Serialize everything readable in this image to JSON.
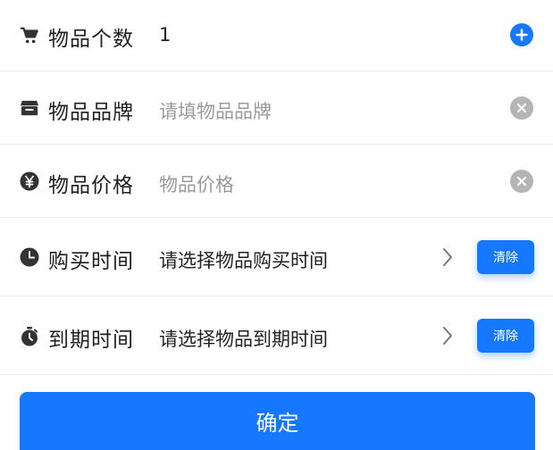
{
  "form": {
    "quantity": {
      "label": "物品个数",
      "value": "1",
      "icon": "cart-icon",
      "action_icon": "add-circle-icon"
    },
    "brand": {
      "label": "物品品牌",
      "placeholder": "请填物品品牌",
      "icon": "store-icon",
      "action_icon": "clear-circle-icon"
    },
    "price": {
      "label": "物品价格",
      "placeholder": "物品价格",
      "icon": "yen-icon",
      "action_icon": "clear-circle-icon"
    },
    "purchase_time": {
      "label": "购买时间",
      "placeholder": "请选择物品购买时间",
      "icon": "clock-icon",
      "clear_label": "清除"
    },
    "expiry_time": {
      "label": "到期时间",
      "placeholder": "请选择物品到期时间",
      "icon": "stopwatch-icon",
      "clear_label": "清除"
    }
  },
  "confirm_label": "确定",
  "colors": {
    "accent": "#1677ff",
    "clear_gray": "#b5b5b5",
    "placeholder": "#9a9a9a",
    "divider": "#ececec"
  }
}
